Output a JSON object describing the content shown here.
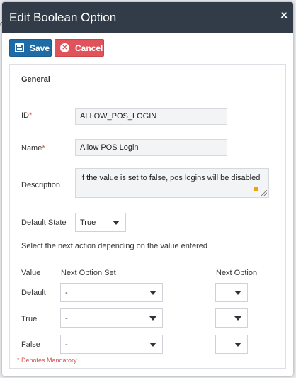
{
  "background": {
    "fragment": "c"
  },
  "modal": {
    "title": "Edit Boolean Option",
    "close_glyph": "×"
  },
  "toolbar": {
    "save_label": "Save",
    "save_icon": "floppy-disk-icon",
    "cancel_label": "Cancel",
    "cancel_icon": "x-circle-icon"
  },
  "form": {
    "section_title": "General",
    "id": {
      "label": "ID",
      "required_mark": "*",
      "value": "ALLOW_POS_LOGIN"
    },
    "name": {
      "label": "Name",
      "required_mark": "*",
      "value": "Allow POS Login"
    },
    "description": {
      "label": "Description",
      "value": "If the value is set to false, pos logins will be disabled"
    },
    "default_state": {
      "label": "Default State",
      "value": "True"
    },
    "instruction": "Select the next action depending on the value entered",
    "table": {
      "col_value": "Value",
      "col_next_option_set": "Next Option Set",
      "col_next_option": "Next Option",
      "rows": [
        {
          "value": "Default",
          "next_option_set": "-",
          "next_option": ""
        },
        {
          "value": "True",
          "next_option_set": "-",
          "next_option": ""
        },
        {
          "value": "False",
          "next_option_set": "-",
          "next_option": ""
        }
      ]
    },
    "mandatory_note": "* Denotes Mandatory"
  },
  "colors": {
    "header_bg": "#313c48",
    "save_bg": "#1f6ba6",
    "cancel_bg": "#e0535b",
    "required": "#d9534f"
  }
}
